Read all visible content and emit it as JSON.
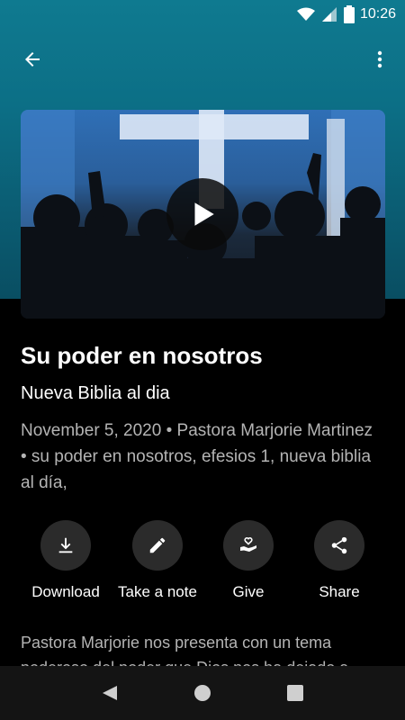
{
  "status_bar": {
    "time": "10:26"
  },
  "app_bar": {},
  "media": {
    "title": "Su poder en nosotros",
    "subtitle": "Nueva Biblia al dia",
    "meta": "November 5, 2020 • Pastora Marjorie Martinez • su poder en nosotros, efesios 1, nueva biblia al día,",
    "description": "Pastora Marjorie nos presenta con un tema poderoso del poder que Dios nos ha dejado a"
  },
  "actions": [
    {
      "label": "Download",
      "icon": "download-icon"
    },
    {
      "label": "Take a note",
      "icon": "pencil-icon"
    },
    {
      "label": "Give",
      "icon": "give-heart-hand-icon"
    },
    {
      "label": "Share",
      "icon": "share-icon"
    }
  ],
  "colors": {
    "header_gradient_top": "#0f7a90",
    "header_gradient_bottom": "#094e62",
    "background": "#000000",
    "action_circle": "#2b2b2b",
    "secondary_text": "#b4b4b4"
  }
}
